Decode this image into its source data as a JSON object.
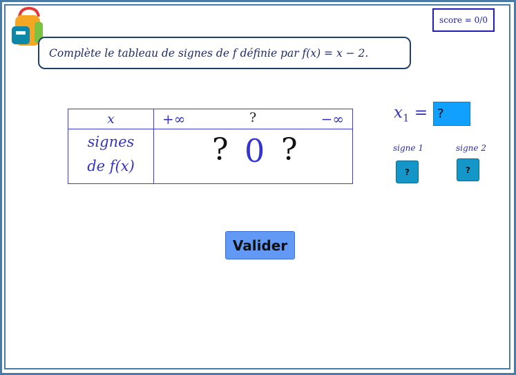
{
  "score": {
    "label": "score = 0/0"
  },
  "instruction": {
    "text": "Complète le tableau de signes de f définie par f(x) = x − 2."
  },
  "sign_table": {
    "x_header": "x",
    "plus_infinity": "+∞",
    "root_placeholder": "?",
    "minus_infinity": "−∞",
    "row_label_line1": "signes",
    "row_label_line2": "de f(x)",
    "sign_left": "?",
    "zero": "0",
    "sign_right": "?"
  },
  "root_input": {
    "label_main": "x",
    "label_sub": "1",
    "label_eq": " = ",
    "value": "?"
  },
  "sign_buttons": [
    {
      "label": "signe 1",
      "value": "?"
    },
    {
      "label": "signe 2",
      "value": "?"
    }
  ],
  "validate_button": {
    "label": "Valider"
  },
  "colors": {
    "frame": "#4a7aa6",
    "table_border": "#3c3cd2",
    "math_text": "#3434c0",
    "input_fill": "#12a0ff",
    "sign_button_fill": "#1596c9",
    "validate_fill": "#6199f5"
  },
  "icons": {
    "logo": "backpack-icon"
  }
}
